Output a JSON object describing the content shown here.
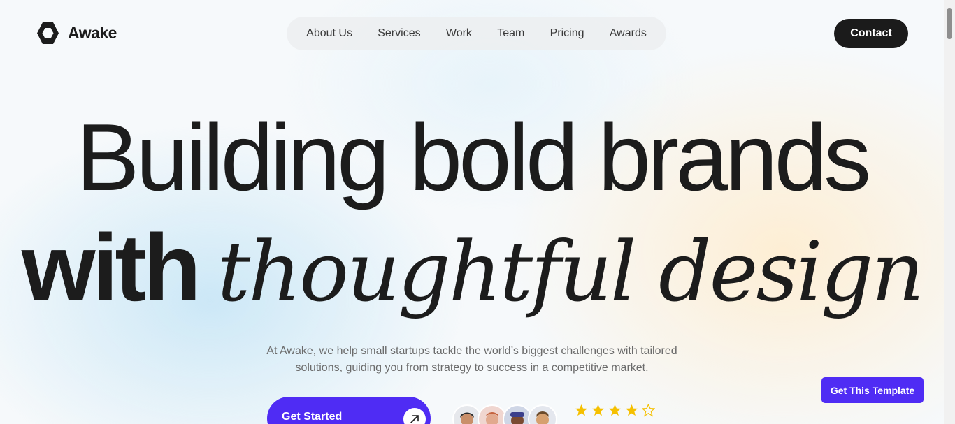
{
  "brand": {
    "name": "Awake"
  },
  "nav": {
    "items": [
      "About Us",
      "Services",
      "Work",
      "Team",
      "Pricing",
      "Awards"
    ]
  },
  "header": {
    "contact_label": "Contact"
  },
  "hero": {
    "headline_line1": "Building bold brands",
    "headline_line2_plain": "with",
    "headline_line2_italic": "thoughtful design",
    "subtitle_line1": "At Awake, we help small startups tackle the world’s biggest challenges with tailored",
    "subtitle_line2": "solutions, guiding you from strategy to success in a competitive market.",
    "cta_label": "Get Started",
    "rating": {
      "filled": 4,
      "total": 5
    }
  },
  "floating": {
    "template_label": "Get This Template"
  },
  "colors": {
    "accent": "#4f2cf4",
    "dark": "#1b1b1b",
    "star": "#f5c000"
  },
  "icons": {
    "logo": "hexagon-logo-icon",
    "cta": "arrow-up-right-icon",
    "rating": "star-icon"
  }
}
